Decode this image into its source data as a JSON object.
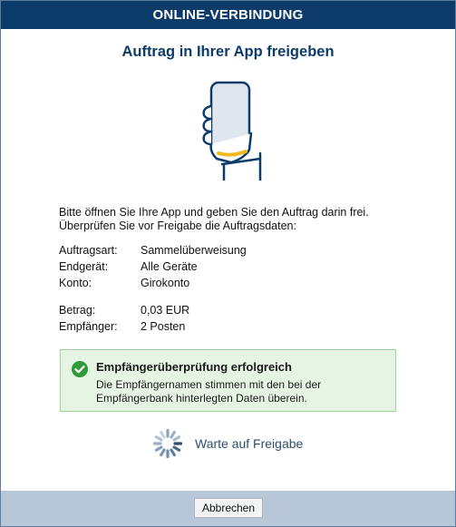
{
  "header": {
    "title": "ONLINE-VERBINDUNG"
  },
  "dialog": {
    "title": "Auftrag in Ihrer App freigeben",
    "illustration_icon": "hand-holding-phone-icon",
    "intro_line1": "Bitte öffnen Sie Ihre App und geben Sie den Auftrag darin frei.",
    "intro_line2": "Überprüfen Sie vor Freigabe die Auftragsdaten:"
  },
  "details": {
    "order_type_label": "Auftragsart:",
    "order_type_value": "Sammelüberweisung",
    "device_label": "Endgerät:",
    "device_value": "Alle Geräte",
    "account_label": "Konto:",
    "account_value": "Girokonto",
    "amount_label": "Betrag:",
    "amount_value": "0,03 EUR",
    "recipient_label": "Empfänger:",
    "recipient_value": "2 Posten"
  },
  "verification": {
    "icon": "check-circle-icon",
    "title": "Empfängerüberprüfung erfolgreich",
    "text": "Die Empfängernamen stimmen mit den bei der Empfängerbank hinterlegten Daten überein."
  },
  "status": {
    "icon": "spinner-icon",
    "label": "Warte auf Freigabe"
  },
  "footer": {
    "cancel_label": "Abbrechen"
  },
  "colors": {
    "header_bg": "#0d3c6a",
    "title": "#0d3c6a",
    "success_bg": "#e6f4e4",
    "success_border": "#9fd39a",
    "success_icon": "#2e9a3a",
    "footer_bg": "#b8c7d8"
  }
}
